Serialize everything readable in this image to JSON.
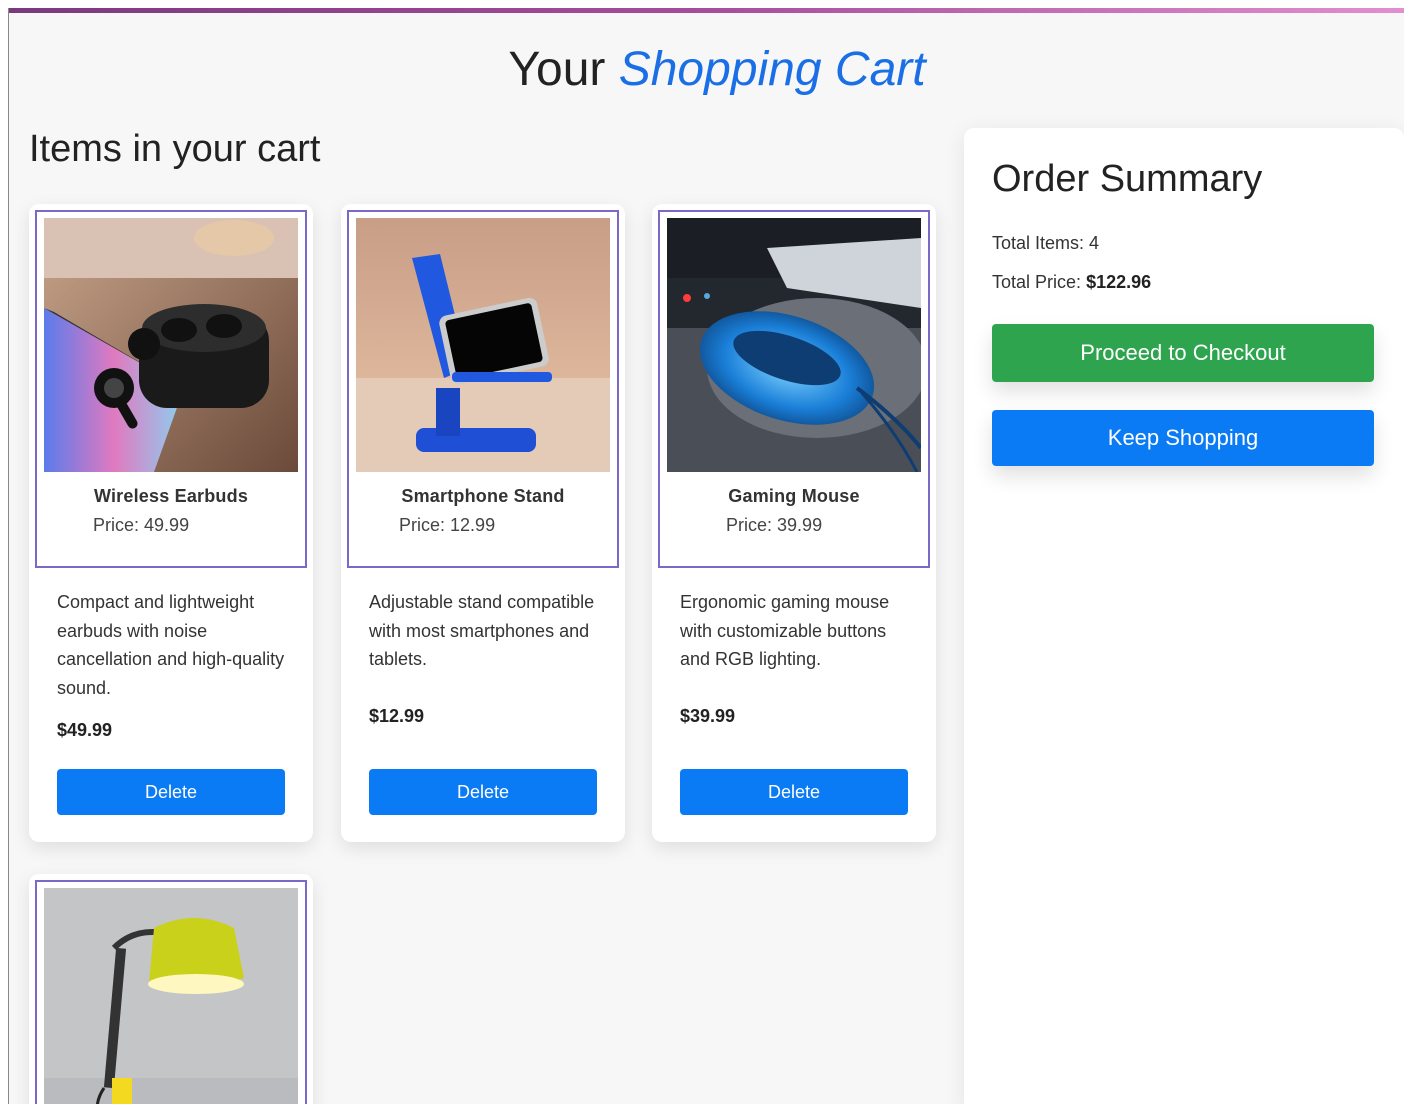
{
  "header": {
    "title_prefix": "Your",
    "title_accent": "Shopping Cart"
  },
  "cart": {
    "heading": "Items in your cart",
    "delete_label": "Delete",
    "items": [
      {
        "name": "Wireless Earbuds",
        "price_label": "Price:",
        "price_value": "49.99",
        "description": "Compact and lightweight earbuds with noise cancellation and high-quality sound.",
        "amount": "$49.99",
        "image_icon": "earbuds-photo"
      },
      {
        "name": "Smartphone Stand",
        "price_label": "Price:",
        "price_value": "12.99",
        "description": "Adjustable stand compatible with most smartphones and tablets.",
        "amount": "$12.99",
        "image_icon": "phone-stand-photo"
      },
      {
        "name": "Gaming Mouse",
        "price_label": "Price:",
        "price_value": "39.99",
        "description": "Ergonomic gaming mouse with customizable buttons and RGB lighting.",
        "amount": "$39.99",
        "image_icon": "gaming-mouse-photo"
      },
      {
        "image_icon": "desk-lamp-photo"
      }
    ]
  },
  "summary": {
    "title": "Order Summary",
    "total_items_label": "Total Items:",
    "total_items_value": "4",
    "total_price_label": "Total Price:",
    "total_price_value": "$122.96",
    "checkout_label": "Proceed to Checkout",
    "keep_label": "Keep Shopping"
  },
  "colors": {
    "accent_blue": "#0b7bf5",
    "checkout_green": "#2ea44f",
    "card_border": "#7b68c8"
  }
}
